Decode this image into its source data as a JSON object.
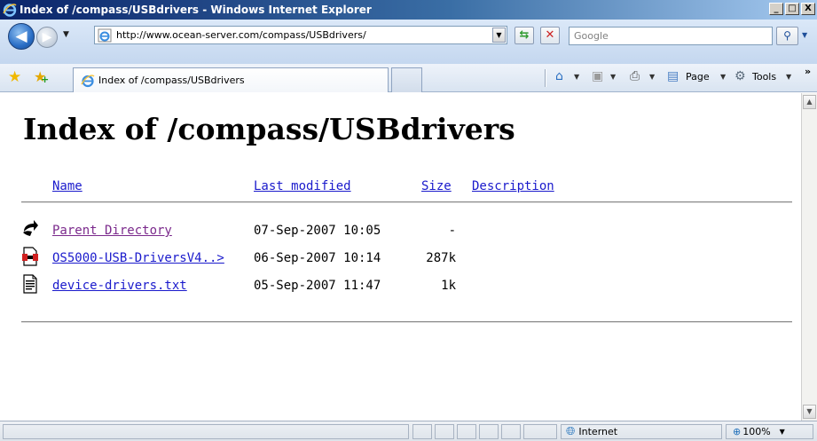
{
  "window": {
    "title": "Index of /compass/USBdrivers - Windows Internet Explorer",
    "minimize": "_",
    "maximize": "□",
    "close": "X"
  },
  "nav": {
    "url": "http://www.ocean-server.com/compass/USBdrivers/",
    "search_placeholder": "Google"
  },
  "tabs": [
    {
      "label": "Index of /compass/USBdrivers"
    }
  ],
  "commands": {
    "page": "Page",
    "tools": "Tools",
    "overflow": "»"
  },
  "page": {
    "heading": "Index of /compass/USBdrivers",
    "columns": {
      "name": "Name",
      "last_modified": "Last modified",
      "size": "Size",
      "description": "Description"
    },
    "rows": [
      {
        "name": "Parent Directory",
        "date": "07-Sep-2007 10:05",
        "size": "-",
        "icon": "parent-directory-icon",
        "visited": true
      },
      {
        "name": "OS5000-USB-DriversV4..>",
        "date": "06-Sep-2007 10:14",
        "size": "287k",
        "icon": "archive-file-icon",
        "visited": false
      },
      {
        "name": "device-drivers.txt",
        "date": "05-Sep-2007 11:47",
        "size": "1k",
        "icon": "text-file-icon",
        "visited": false
      }
    ]
  },
  "status": {
    "zone": "Internet",
    "zoom": "100%"
  },
  "colors": {
    "link": "#1a1acc",
    "visited_link": "#7b2a8c",
    "title_bar": "#0a246a"
  }
}
